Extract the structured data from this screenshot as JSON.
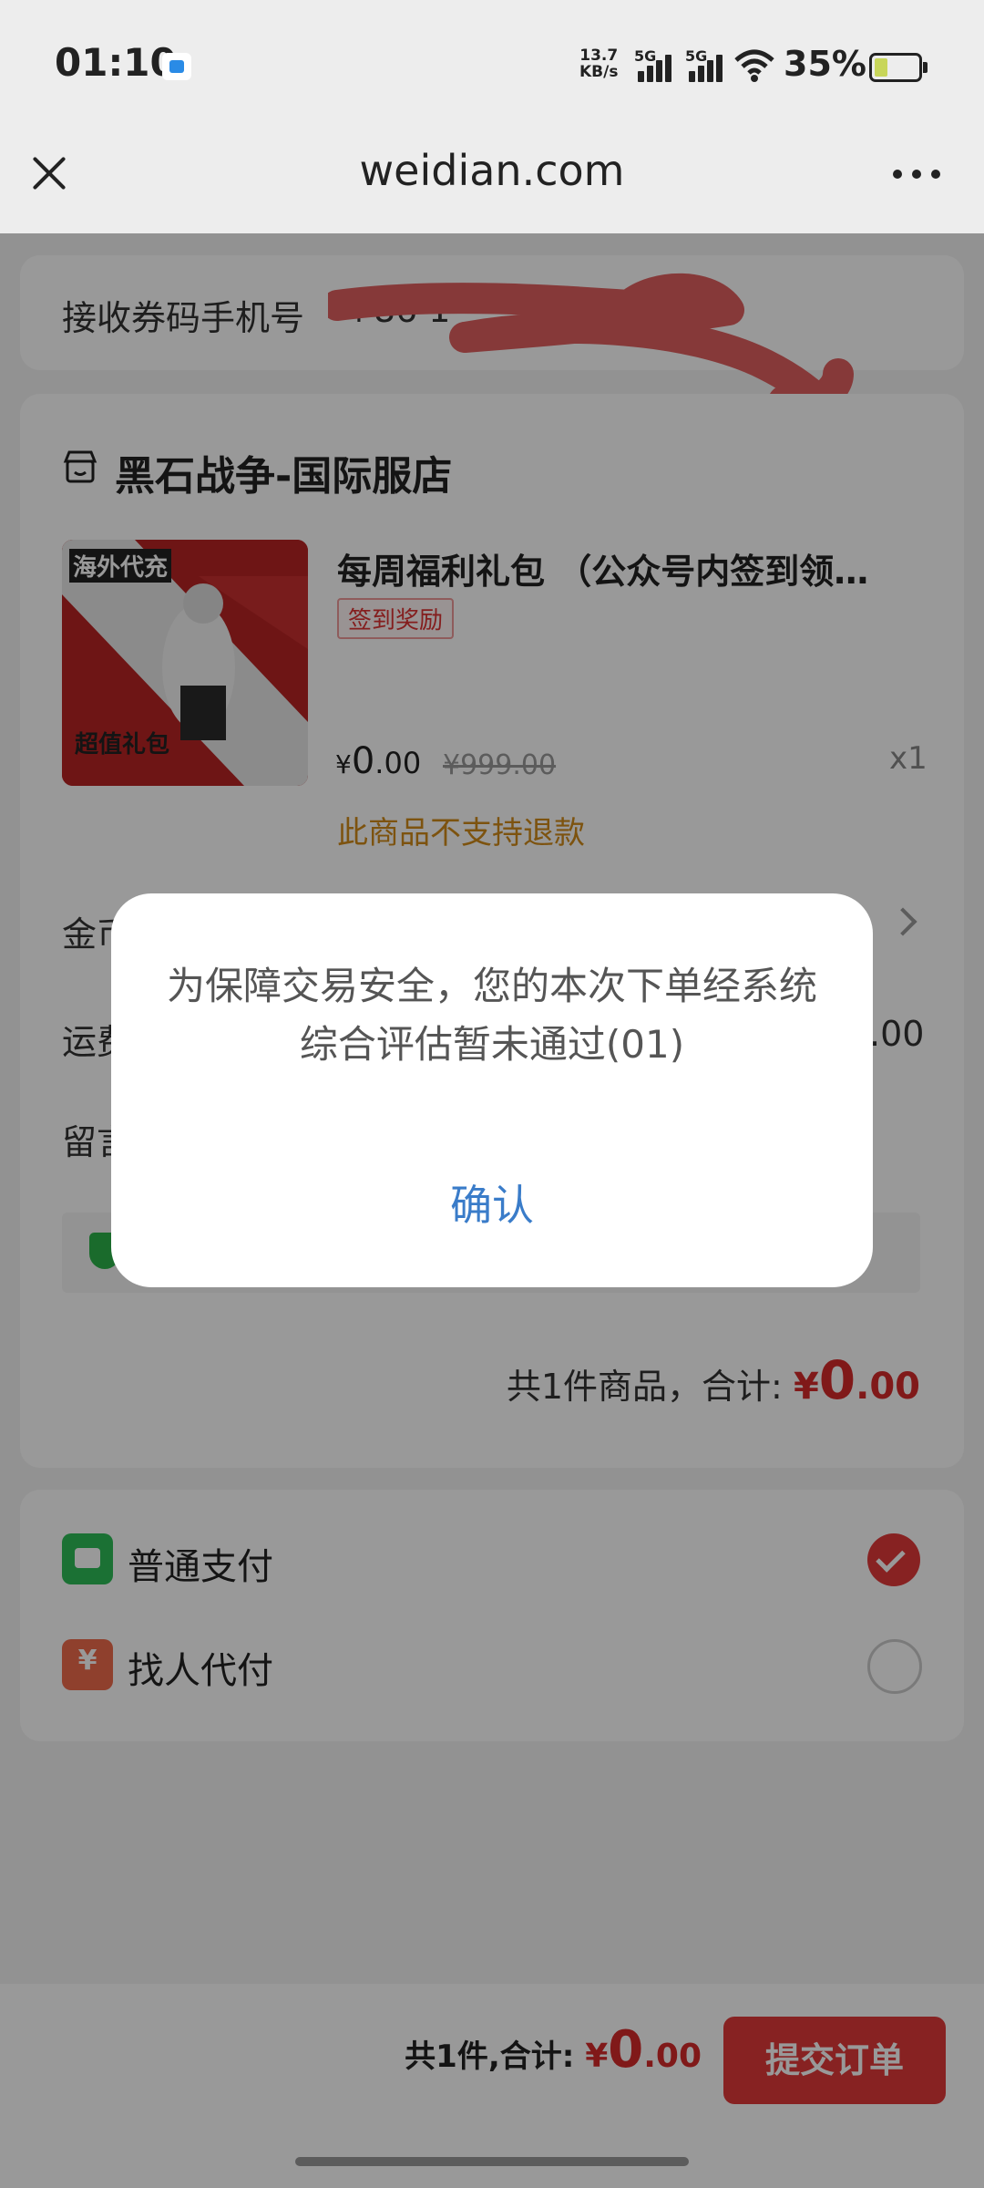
{
  "status_bar": {
    "time": "01:10",
    "net_speed_value": "13.7",
    "net_speed_unit": "KB/s",
    "sim1_label": "5G",
    "sim2_label": "5G",
    "battery_pct": "35%"
  },
  "nav": {
    "title": "weidian.com",
    "close_icon": "close-icon",
    "more_icon": "more-dots-icon"
  },
  "phone_field": {
    "label": "接收券码手机号",
    "value": "+86 1"
  },
  "store": {
    "name": "黑石战争-国际服店",
    "icon": "store-icon"
  },
  "product": {
    "title": "每周福利礼包 （公众号内签到领…",
    "tag": "签到奖励",
    "price_currency": "¥",
    "price_int": "0",
    "price_dec": ".00",
    "original_price": "¥999.00",
    "quantity": "x1",
    "notice": "此商品不支持退款",
    "image_text_top": "海外代充",
    "image_text_bottom": "超值礼包"
  },
  "rows": {
    "coins_label": "金币",
    "freight_label": "运费",
    "freight_value": ".00",
    "note_label": "留言"
  },
  "summary": {
    "text": "共1件商品，合计: ",
    "currency": "¥",
    "amount_int": "0",
    "amount_dec": ".00"
  },
  "payment": {
    "normal_label": "普通支付",
    "friend_label": "找人代付",
    "selected": "普通支付"
  },
  "bottom": {
    "total_text": "共1件,合计: ",
    "currency": "¥",
    "amount_int": "0",
    "amount_dec": ".00",
    "submit_label": "提交订单"
  },
  "dialog": {
    "message": "为保障交易安全，您的本次下单经系统综合评估暂未通过(01)",
    "confirm_label": "确认"
  },
  "colors": {
    "accent_red": "#e23a3a",
    "dialog_link": "#3a7cc9",
    "warning_orange": "#d08a1a",
    "pay_green": "#2dbd58"
  }
}
